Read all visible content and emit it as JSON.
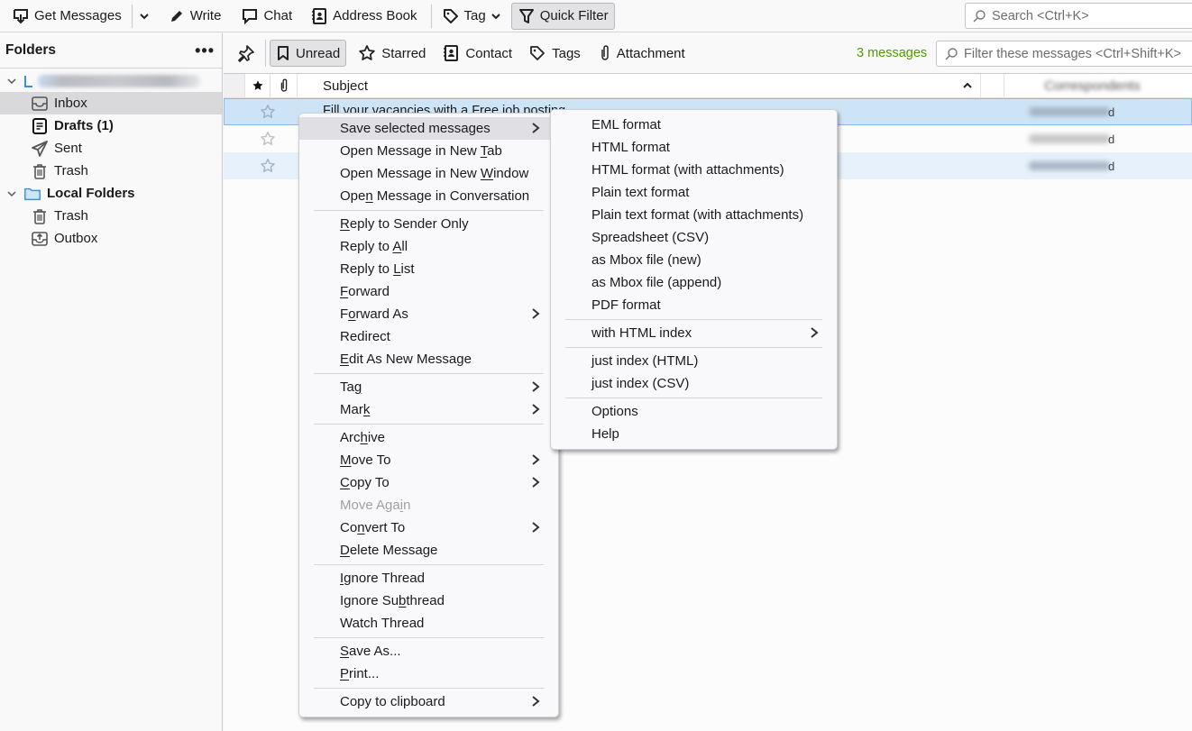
{
  "toolbar": {
    "get_messages": "Get Messages",
    "write": "Write",
    "chat": "Chat",
    "address_book": "Address Book",
    "tag": "Tag",
    "quick_filter": "Quick Filter",
    "search_placeholder": "Search <Ctrl+K>"
  },
  "folders": {
    "title": "Folders",
    "more_label": "•••",
    "account_name": "[blurred account]",
    "items": [
      {
        "label": "Inbox",
        "icon": "inbox-icon",
        "selected": true
      },
      {
        "label": "Drafts (1)",
        "icon": "drafts-icon",
        "bold": true
      },
      {
        "label": "Sent",
        "icon": "sent-icon"
      },
      {
        "label": "Trash",
        "icon": "trash-icon"
      }
    ],
    "local": {
      "label": "Local Folders",
      "items": [
        {
          "label": "Trash",
          "icon": "trash-icon"
        },
        {
          "label": "Outbox",
          "icon": "outbox-icon"
        }
      ]
    }
  },
  "quick_filter": {
    "buttons": [
      "Unread",
      "Starred",
      "Contact",
      "Tags",
      "Attachment"
    ],
    "message_count": "3 messages",
    "filter_placeholder": "Filter these messages <Ctrl+Shift+K>"
  },
  "thread": {
    "columns": {
      "subject": "Subject",
      "correspondents": "Correspondents"
    },
    "rows": [
      {
        "subject": "Fill your vacancies with a Free job posting",
        "correspondent_tail": "d",
        "selected": true
      },
      {
        "subject": "",
        "correspondent_tail": "d"
      },
      {
        "subject": "",
        "correspondent_tail": "d",
        "selected": true
      }
    ]
  },
  "context_menu": {
    "groups": [
      [
        {
          "label": "Save selected messages",
          "submenu": true,
          "hover": true
        },
        {
          "pre": "Open Message in New ",
          "ul": "T",
          "post": "ab"
        },
        {
          "pre": "Open Message in New ",
          "ul": "W",
          "post": "indow"
        },
        {
          "pre": "Ope",
          "ul": "n",
          "post": " Message in Conversation"
        }
      ],
      [
        {
          "pre": "",
          "ul": "R",
          "post": "eply to Sender Only"
        },
        {
          "pre": "Reply to ",
          "ul": "A",
          "post": "ll"
        },
        {
          "pre": "Reply to ",
          "ul": "L",
          "post": "ist"
        },
        {
          "pre": "",
          "ul": "F",
          "post": "orward"
        },
        {
          "pre": "F",
          "ul": "o",
          "post": "rward As",
          "submenu": true
        },
        {
          "label": "Redirect"
        },
        {
          "pre": "",
          "ul": "E",
          "post": "dit As New Message"
        }
      ],
      [
        {
          "pre": "Ta",
          "ul": "g",
          "post": "",
          "submenu": true
        },
        {
          "pre": "Mar",
          "ul": "k",
          "post": "",
          "submenu": true
        }
      ],
      [
        {
          "pre": "Arc",
          "ul": "h",
          "post": "ive"
        },
        {
          "pre": "",
          "ul": "M",
          "post": "ove To",
          "submenu": true
        },
        {
          "pre": "",
          "ul": "C",
          "post": "opy To",
          "submenu": true
        },
        {
          "pre": "Move Aga",
          "ul": "i",
          "post": "n",
          "disabled": true
        },
        {
          "pre": "Co",
          "ul": "n",
          "post": "vert To",
          "submenu": true
        },
        {
          "pre": "",
          "ul": "D",
          "post": "elete Message"
        }
      ],
      [
        {
          "pre": "",
          "ul": "I",
          "post": "gnore Thread"
        },
        {
          "pre": "Ignore Su",
          "ul": "b",
          "post": "thread"
        },
        {
          "label": "Watch Thread"
        }
      ],
      [
        {
          "pre": "",
          "ul": "S",
          "post": "ave As..."
        },
        {
          "pre": "",
          "ul": "P",
          "post": "rint..."
        }
      ],
      [
        {
          "label": "Copy to clipboard",
          "submenu": true
        }
      ]
    ]
  },
  "save_submenu": {
    "groups": [
      [
        "EML format",
        "HTML format",
        "HTML format (with attachments)",
        "Plain text format",
        "Plain text format (with attachments)",
        "Spreadsheet (CSV)",
        "as Mbox file (new)",
        "as Mbox file (append)",
        "PDF format"
      ],
      [
        {
          "label": "with HTML index",
          "submenu": true
        }
      ],
      [
        "just index (HTML)",
        "just index (CSV)"
      ],
      [
        "Options",
        "Help"
      ]
    ]
  },
  "colors": {
    "selection": "#cde4f7",
    "message_count": "#4e9a06",
    "folder_accent": "#3b8ee8"
  }
}
